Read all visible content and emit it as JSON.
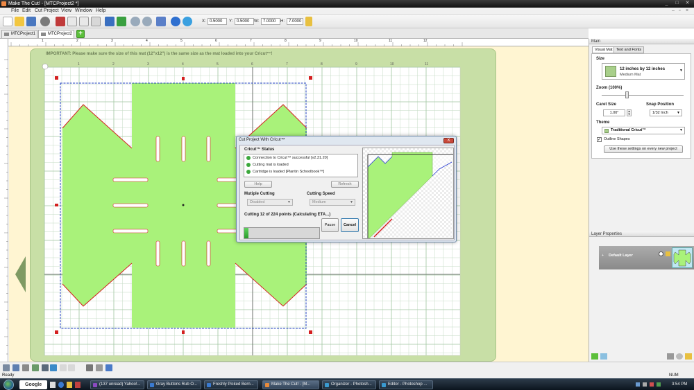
{
  "window": {
    "title": "Make The Cut! - [MTCProject2 *]"
  },
  "menu": [
    "File",
    "Edit",
    "Cut Project",
    "View",
    "Window",
    "Help"
  ],
  "toolbar": {
    "x_label": "X:",
    "x_value": "0.5000",
    "y_label": "Y:",
    "y_value": "0.5000",
    "w_label": "W:",
    "w_value": "7.0000",
    "h_label": "H:",
    "h_value": "7.0000"
  },
  "tabs": [
    {
      "label": "MTCProject1 *"
    },
    {
      "label": "MTCProject2 *"
    }
  ],
  "ruler_top": [
    "1",
    "2",
    "3",
    "4",
    "5",
    "6",
    "7",
    "8",
    "9",
    "10",
    "11",
    "12"
  ],
  "ruler_mat": [
    "1",
    "2",
    "3",
    "4",
    "5",
    "6",
    "7",
    "8",
    "9",
    "10",
    "11"
  ],
  "canvas": {
    "mat_note": "IMPORTANT: Please make sure the size of this mat (12\"x12\") is the same size as the mat loaded into your Cricut™!"
  },
  "dialog": {
    "title": "Cut Project With Cricut™",
    "close": "X",
    "status_label": "Cricut™ Status",
    "status_lines": [
      "Connection to Cricut™ successful [v2.31.20]",
      "Cutting mat is loaded",
      "Cartridge is loaded [Plantin Schoolbook™]"
    ],
    "help": "Help",
    "refresh": "Refresh",
    "multiple_cutting_label": "Mutiple Cutting",
    "multiple_cutting_value": "Disabled",
    "cutting_speed_label": "Cutting Speed",
    "cutting_speed_value": "Medium",
    "progress_text": "Cutting 12 of 224 points (Calculating ETA...)",
    "progress": 0.054,
    "pause": "Pause",
    "cancel": "Cancel"
  },
  "right_panel": {
    "main_header": "Main",
    "tab_visual_mat": "Visual Mat",
    "tab_text_fonts": "Text and Fonts",
    "size_label": "Size",
    "size_value": "12 inches by 12 inches",
    "size_sub": "Medium Mat",
    "zoom_label": "Zoom (100%)",
    "caret_label": "Caret Size",
    "caret_value": "1.00\"",
    "snap_label": "Snap Position",
    "snap_value": "1/32 Inch",
    "theme_label": "Theme",
    "theme_value": "Traditional Cricut™",
    "outline_label": "Outline Shapes",
    "use_settings": "Use these settings on every new project",
    "layer_header": "Layer Properties",
    "layer_name": "Default Layer"
  },
  "statusbar": {
    "left": "Ready",
    "right": "NUM"
  },
  "taskbar": {
    "google": "Google",
    "items": [
      {
        "label": "(137 unread) Yahoo!..."
      },
      {
        "label": "Gray Buttons Rub O..."
      },
      {
        "label": "Freshly Picked Bern..."
      },
      {
        "label": "Make The Cut! - [M..."
      },
      {
        "label": "Organizer - Photosh..."
      },
      {
        "label": "Editor - Photoshop ..."
      }
    ],
    "clock": "3:54 PM"
  },
  "colors": {
    "accent_green": "#a9f27a",
    "mat": "#c8dfa6",
    "progress": "#2fae2f",
    "cut_red": "#d42020"
  }
}
